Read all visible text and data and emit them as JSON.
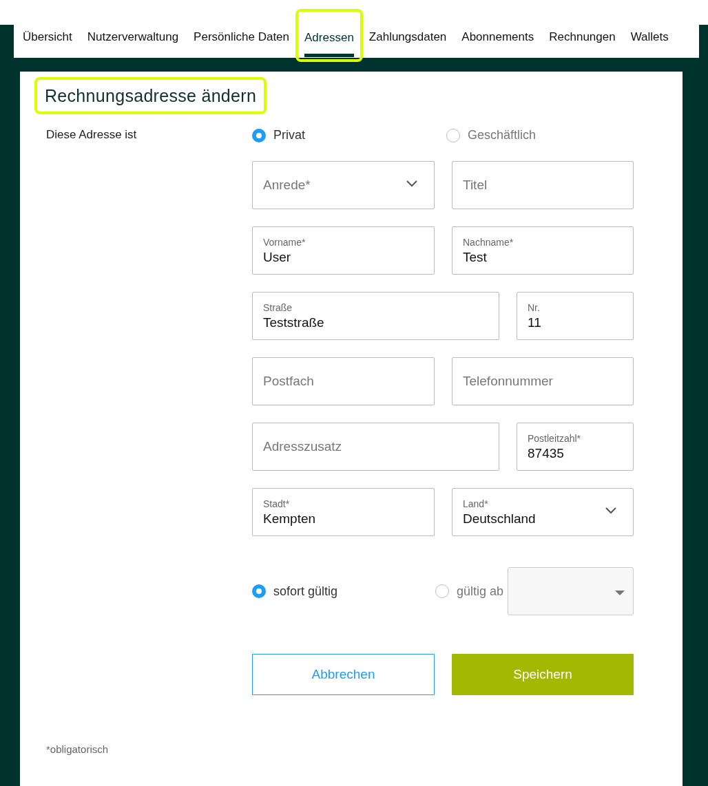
{
  "tabs": [
    {
      "label": "Übersicht",
      "selected": false,
      "highlighted": false
    },
    {
      "label": "Nutzerverwaltung",
      "selected": false,
      "highlighted": false
    },
    {
      "label": "Persönliche Daten",
      "selected": false,
      "highlighted": false
    },
    {
      "label": "Adressen",
      "selected": true,
      "highlighted": true
    },
    {
      "label": "Zahlungsdaten",
      "selected": false,
      "highlighted": false
    },
    {
      "label": "Abonnements",
      "selected": false,
      "highlighted": false
    },
    {
      "label": "Rechnungen",
      "selected": false,
      "highlighted": false
    },
    {
      "label": "Wallets",
      "selected": false,
      "highlighted": false
    }
  ],
  "heading": {
    "text": "Rechnungsadresse ändern",
    "highlighted": true
  },
  "address_type": {
    "label": "Diese Adresse ist",
    "options": [
      {
        "label": "Privat",
        "selected": true
      },
      {
        "label": "Geschäftlich",
        "selected": false
      }
    ]
  },
  "rows": [
    {
      "kind": "pair",
      "fields": [
        {
          "kind": "select",
          "placeholder": "Anrede*"
        },
        {
          "kind": "text",
          "placeholder": "Titel"
        }
      ]
    },
    {
      "kind": "pair",
      "fields": [
        {
          "kind": "text",
          "label": "Vorname*",
          "value": "User"
        },
        {
          "kind": "text",
          "label": "Nachname*",
          "value": "Test"
        }
      ]
    },
    {
      "kind": "main-side",
      "fields": [
        {
          "kind": "text",
          "label": "Straße",
          "value": "Teststraße"
        },
        {
          "kind": "text",
          "label": "Nr.",
          "value": "11"
        }
      ]
    },
    {
      "kind": "pair",
      "fields": [
        {
          "kind": "text",
          "placeholder": "Postfach"
        },
        {
          "kind": "text",
          "placeholder": "Telefonnummer"
        }
      ]
    },
    {
      "kind": "main-side",
      "fields": [
        {
          "kind": "text",
          "placeholder": "Adresszusatz"
        },
        {
          "kind": "text",
          "label": "Postleitzahl*",
          "value": "87435"
        }
      ]
    },
    {
      "kind": "pair",
      "fields": [
        {
          "kind": "text",
          "label": "Stadt*",
          "value": "Kempten"
        },
        {
          "kind": "select",
          "label": "Land*",
          "value": "Deutschland"
        }
      ]
    }
  ],
  "validity": {
    "options": [
      {
        "label": "sofort gültig",
        "selected": true
      },
      {
        "label": "gültig ab",
        "selected": false
      }
    ]
  },
  "buttons": [
    {
      "kind": "secondary",
      "label": "Abbrechen"
    },
    {
      "kind": "primary",
      "label": "Speichern"
    }
  ],
  "footnote": "*obligatorisch"
}
